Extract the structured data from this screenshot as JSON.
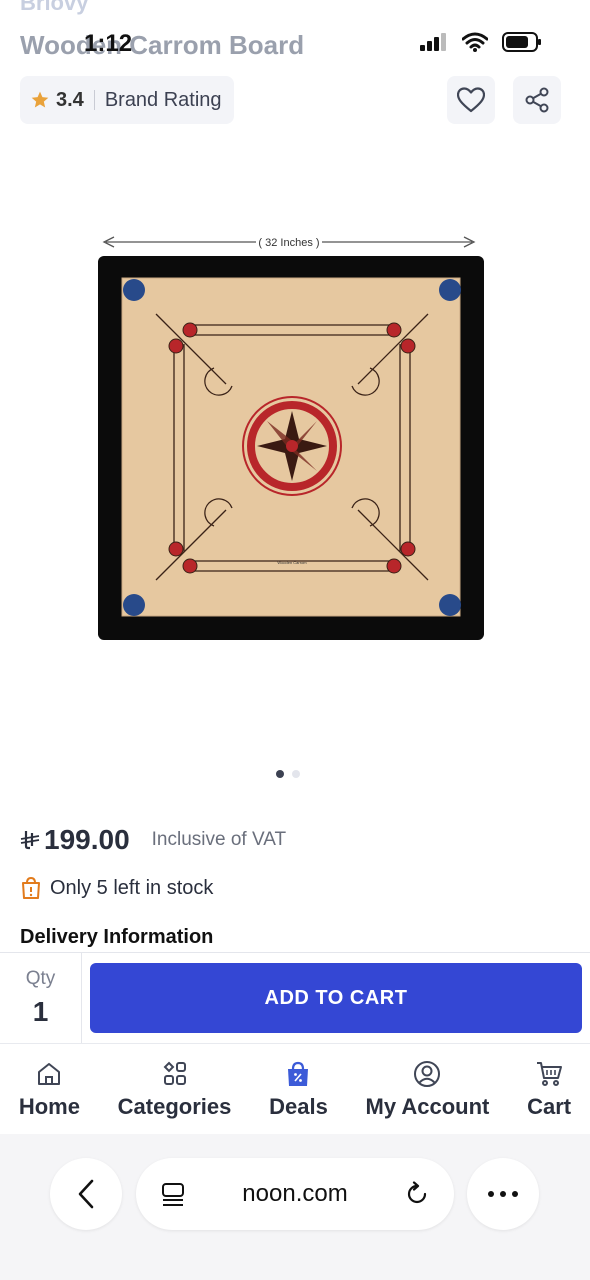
{
  "status_bar": {
    "time": "1:12"
  },
  "header": {
    "brand": "Briovy",
    "title": "Wooden Carrom Board"
  },
  "rating": {
    "value": "3.4",
    "label": "Brand Rating"
  },
  "product_image": {
    "dimension_label": "( 32 Inches )",
    "board_text": "Wooden Carrom"
  },
  "carousel": {
    "total": 2,
    "active": 1
  },
  "price": {
    "amount": "199.00",
    "vat_text": "Inclusive of VAT"
  },
  "stock": {
    "text": "Only 5 left in stock"
  },
  "delivery": {
    "heading": "Delivery Information"
  },
  "purchase": {
    "qty_label": "Qty",
    "qty_value": "1",
    "add_to_cart_label": "ADD TO CART"
  },
  "bottom_nav": {
    "home": "Home",
    "categories": "Categories",
    "deals": "Deals",
    "account": "My Account",
    "cart": "Cart"
  },
  "browser": {
    "url": "noon.com"
  },
  "colors": {
    "primary": "#3447d4",
    "deals_accent": "#3c5bd8",
    "star": "#e9a23b",
    "stock_icon": "#e27b1c"
  },
  "icons": [
    "star-icon",
    "heart-icon",
    "share-icon",
    "currency-icon",
    "shopping-bag-icon",
    "home-icon",
    "categories-icon",
    "deals-icon",
    "account-icon",
    "cart-icon",
    "back-icon",
    "tabs-icon",
    "reload-icon",
    "more-icon"
  ]
}
